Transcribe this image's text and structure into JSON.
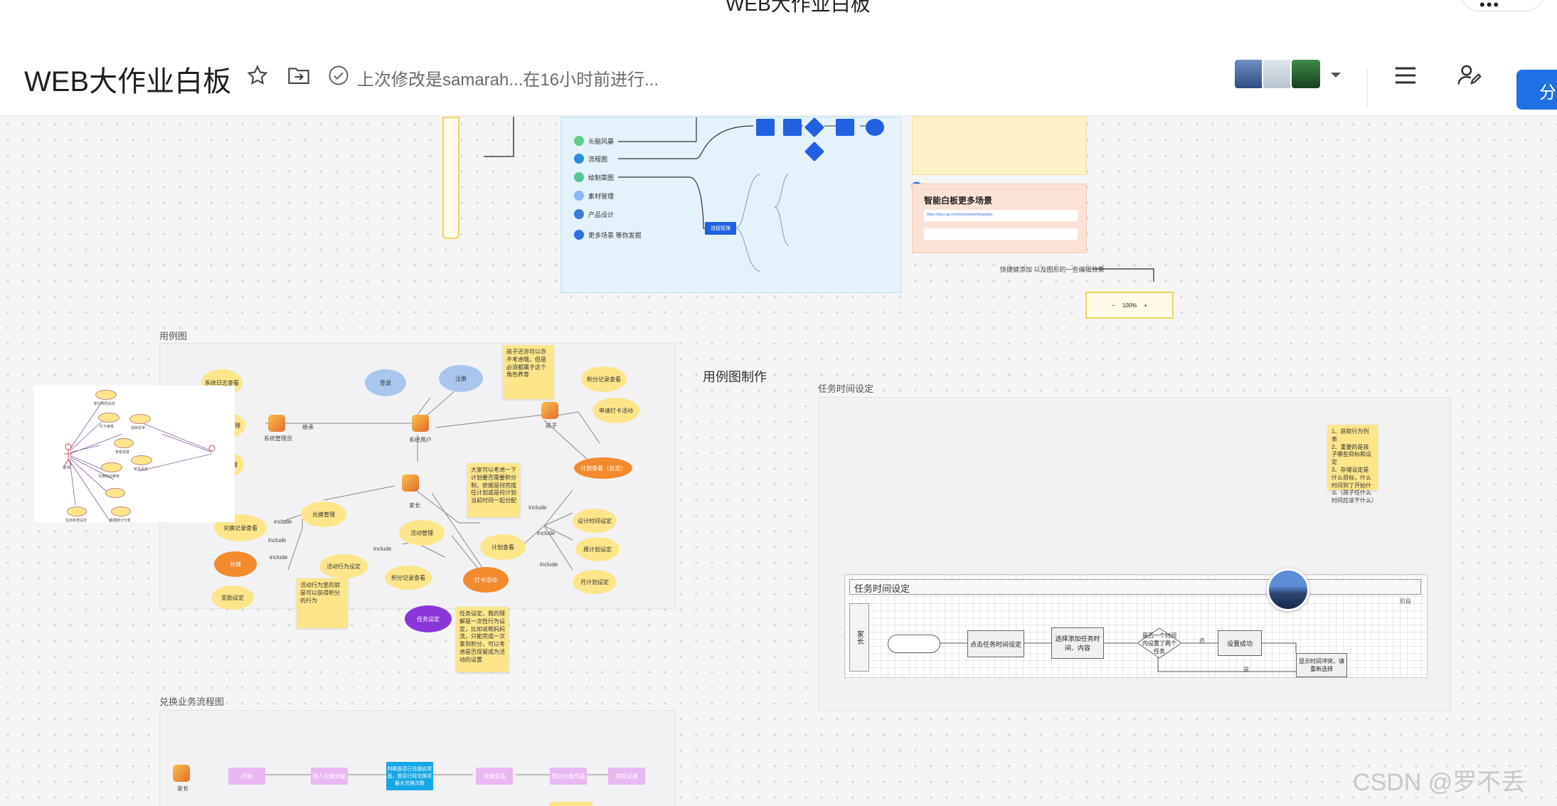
{
  "window": {
    "title": "WEB大作业白板"
  },
  "header": {
    "title": "WEB大作业白板",
    "last_edit": "上次修改是samarah...在16小时前进行...",
    "share_label": "分"
  },
  "icons": {
    "star": "star-icon",
    "move": "move-to-folder-icon",
    "status": "check-circle-icon",
    "caret": "chevron-down-icon",
    "menu": "hamburger-menu-icon",
    "user": "user-edit-icon"
  },
  "colors": {
    "accent": "#1f6fe5",
    "note": "#fde68a",
    "ellipse_orange": "#f38a2d",
    "mindmap_bg": "#e3f2fb"
  },
  "canvas": {
    "usecase_frame_label": "用例图",
    "usecase_heading": "用例图制作",
    "task_frame_label": "任务时间设定",
    "exchange_frame_label": "兑换业务流程图",
    "zoom_readout": "100%"
  },
  "mindmap": {
    "items": [
      "头脑风暴",
      "流程图",
      "绘制菜图",
      "素材管理",
      "产品设计",
      "更多场景 等你发掘"
    ],
    "center": "流程管理"
  },
  "smart_board": {
    "title": "智能白板更多场景",
    "link": "https://docs.qq.com/smartsheet/templates"
  },
  "mid_text": "快捷键添加    以及图形的一些编辑效果",
  "usecase": {
    "login": "登录",
    "register": "注册",
    "system_admin": "系统管理员",
    "system_user": "系统用户",
    "kid": "孩子",
    "parent": "家长",
    "kid_manage": "孩子信息管理",
    "parent_manage": "家长信息管理",
    "system_log": "系统日志查看",
    "points_view": "积分记录查看",
    "apply_punch": "申请打卡活动",
    "plan_view": "计划查看（总览）",
    "plan_time": "设计时间设定",
    "weekly_plan": "周计划设定",
    "month_plan": "月计划设定",
    "plan_check": "计划查看",
    "activity_manage": "活动管理",
    "reward_manage": "兑换管理",
    "reward_record": "兑换记录查看",
    "exchange": "兑换",
    "reward_set": "奖励设定",
    "activity_set": "活动行为设定",
    "points_record": "积分记录查看",
    "punch": "打卡活动",
    "task_set": "任务设定",
    "include": "include",
    "extend": "继承",
    "note1": "孩子还亦可以亦不考虑哦，但是必须都属于这个角色养育",
    "note2": "大家可以考虑一下计划要否需要积分制，依据是何完成任计划或是何计划当前时间一起分配",
    "note3": "活动行为里的就是可以获得积分的行为",
    "note4": "任务设定，我的理解是一次性行为设定，比如说帮妈妈洗，只能完成一次拿到积分，可以考虑是否保留成为活动的设置"
  },
  "small_diagram": {
    "actor": "家长",
    "items": [
      "积分规则设定",
      "打卡审核",
      "成就名单",
      "查看进度",
      "兑换商品审核",
      "奖品设定",
      "任务新增设定",
      "数据统计分析"
    ]
  },
  "task_time": {
    "note": "1、获取行为列表\n2、重要的是孩子哪些目标和设定\n3、存储设定是什么目标，什么时间到了开始什么（孩子任什么时间应该干什么）",
    "diagram_title": "任务时间设定",
    "lane": "家长",
    "right_tag": "阶段",
    "steps": [
      "点击任务时间设定",
      "选择添加任务时间、内容",
      "是否一个时间内设置了两个任务",
      "设置成功",
      "显示时间冲突，请重新选择"
    ],
    "yes": "否",
    "no": "是"
  },
  "exchange_flow": {
    "actor": "家长",
    "steps": [
      "开始",
      "进入兑换功能",
      "判断是否已兑换此奖品，是否已经兑换至最大兑换次数",
      "兑换奖品",
      "成功兑换奖品",
      "完成兑换"
    ]
  },
  "watermark": "CSDN @罗不丢"
}
